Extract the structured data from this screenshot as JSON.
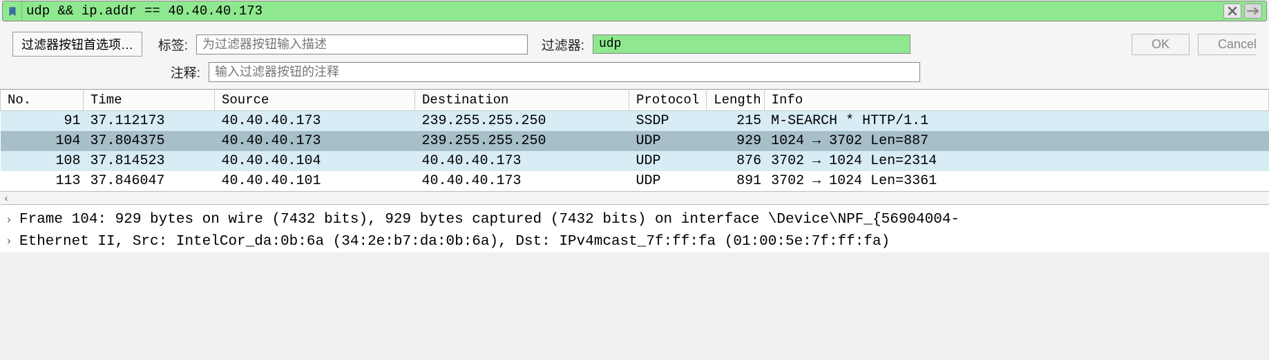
{
  "filter": {
    "expression": "udp && ip.addr == 40.40.40.173"
  },
  "toolbar": {
    "pref_button": "过滤器按钮首选项…",
    "label_tag": "标签:",
    "tag_placeholder": "为过滤器按钮输入描述",
    "label_filter": "过滤器:",
    "filter_value": "udp",
    "label_comment": "注释:",
    "comment_placeholder": "输入过滤器按钮的注释",
    "ok": "OK",
    "cancel": "Cancel"
  },
  "columns": {
    "no": "No.",
    "time": "Time",
    "source": "Source",
    "destination": "Destination",
    "protocol": "Protocol",
    "length": "Length",
    "info": "Info"
  },
  "packets": [
    {
      "no": "91",
      "time": "37.112173",
      "src": "40.40.40.173",
      "dst": "239.255.255.250",
      "proto": "SSDP",
      "len": "215",
      "info": "M-SEARCH * HTTP/1.1",
      "cls": "light"
    },
    {
      "no": "104",
      "time": "37.804375",
      "src": "40.40.40.173",
      "dst": "239.255.255.250",
      "proto": "UDP",
      "len": "929",
      "info": "1024 → 3702 Len=887",
      "cls": "selected"
    },
    {
      "no": "108",
      "time": "37.814523",
      "src": "40.40.40.104",
      "dst": "40.40.40.173",
      "proto": "UDP",
      "len": "876",
      "info": "3702 → 1024 Len=2314",
      "cls": "light"
    },
    {
      "no": "113",
      "time": "37.846047",
      "src": "40.40.40.101",
      "dst": "40.40.40.173",
      "proto": "UDP",
      "len": "891",
      "info": "3702 → 1024 Len=3361",
      "cls": ""
    }
  ],
  "detail": {
    "line1": "Frame 104: 929 bytes on wire (7432 bits), 929 bytes captured (7432 bits) on interface \\Device\\NPF_{56904004-",
    "line2": "Ethernet II, Src: IntelCor_da:0b:6a (34:2e:b7:da:0b:6a), Dst: IPv4mcast_7f:ff:fa (01:00:5e:7f:ff:fa)"
  }
}
